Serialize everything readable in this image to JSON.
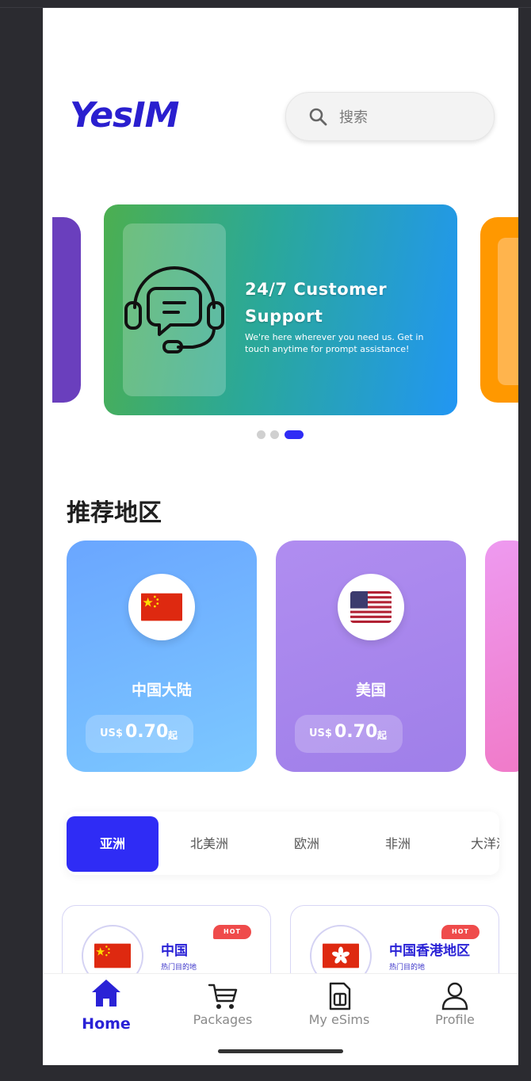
{
  "brand": {
    "logo_text": "YesIM",
    "accent": "#2f2cf5"
  },
  "search": {
    "placeholder": "搜索",
    "icon": "search-icon"
  },
  "banner": {
    "title": "24/7 Customer Support",
    "description": "We're here wherever you need us. Get in touch anytime for prompt assistance!",
    "icon": "headset-support-icon",
    "active_slide": 3,
    "slide_count": 3
  },
  "recommended": {
    "title": "推荐地区",
    "cards": [
      {
        "name": "中国大陆",
        "currency": "US$",
        "price": "0.70",
        "suffix": "起",
        "flag": "china-flag"
      },
      {
        "name": "美国",
        "currency": "US$",
        "price": "0.70",
        "suffix": "起",
        "flag": "usa-flag"
      }
    ]
  },
  "tabs": {
    "items": [
      "亚洲",
      "北美洲",
      "欧洲",
      "非洲",
      "大洋洲"
    ],
    "active": 0
  },
  "destinations": [
    {
      "name": "中国",
      "subtitle": "热门目的地",
      "badge": "HOT",
      "flag": "china-flag"
    },
    {
      "name": "中国香港地区",
      "subtitle": "热门目的地",
      "badge": "HOT",
      "flag": "hong-kong-flag"
    }
  ],
  "nav": {
    "items": [
      {
        "label": "Home",
        "icon": "home-icon",
        "active": true
      },
      {
        "label": "Packages",
        "icon": "cart-icon",
        "active": false
      },
      {
        "label": "My eSims",
        "icon": "sim-card-icon",
        "active": false
      },
      {
        "label": "Profile",
        "icon": "user-icon",
        "active": false
      }
    ]
  }
}
